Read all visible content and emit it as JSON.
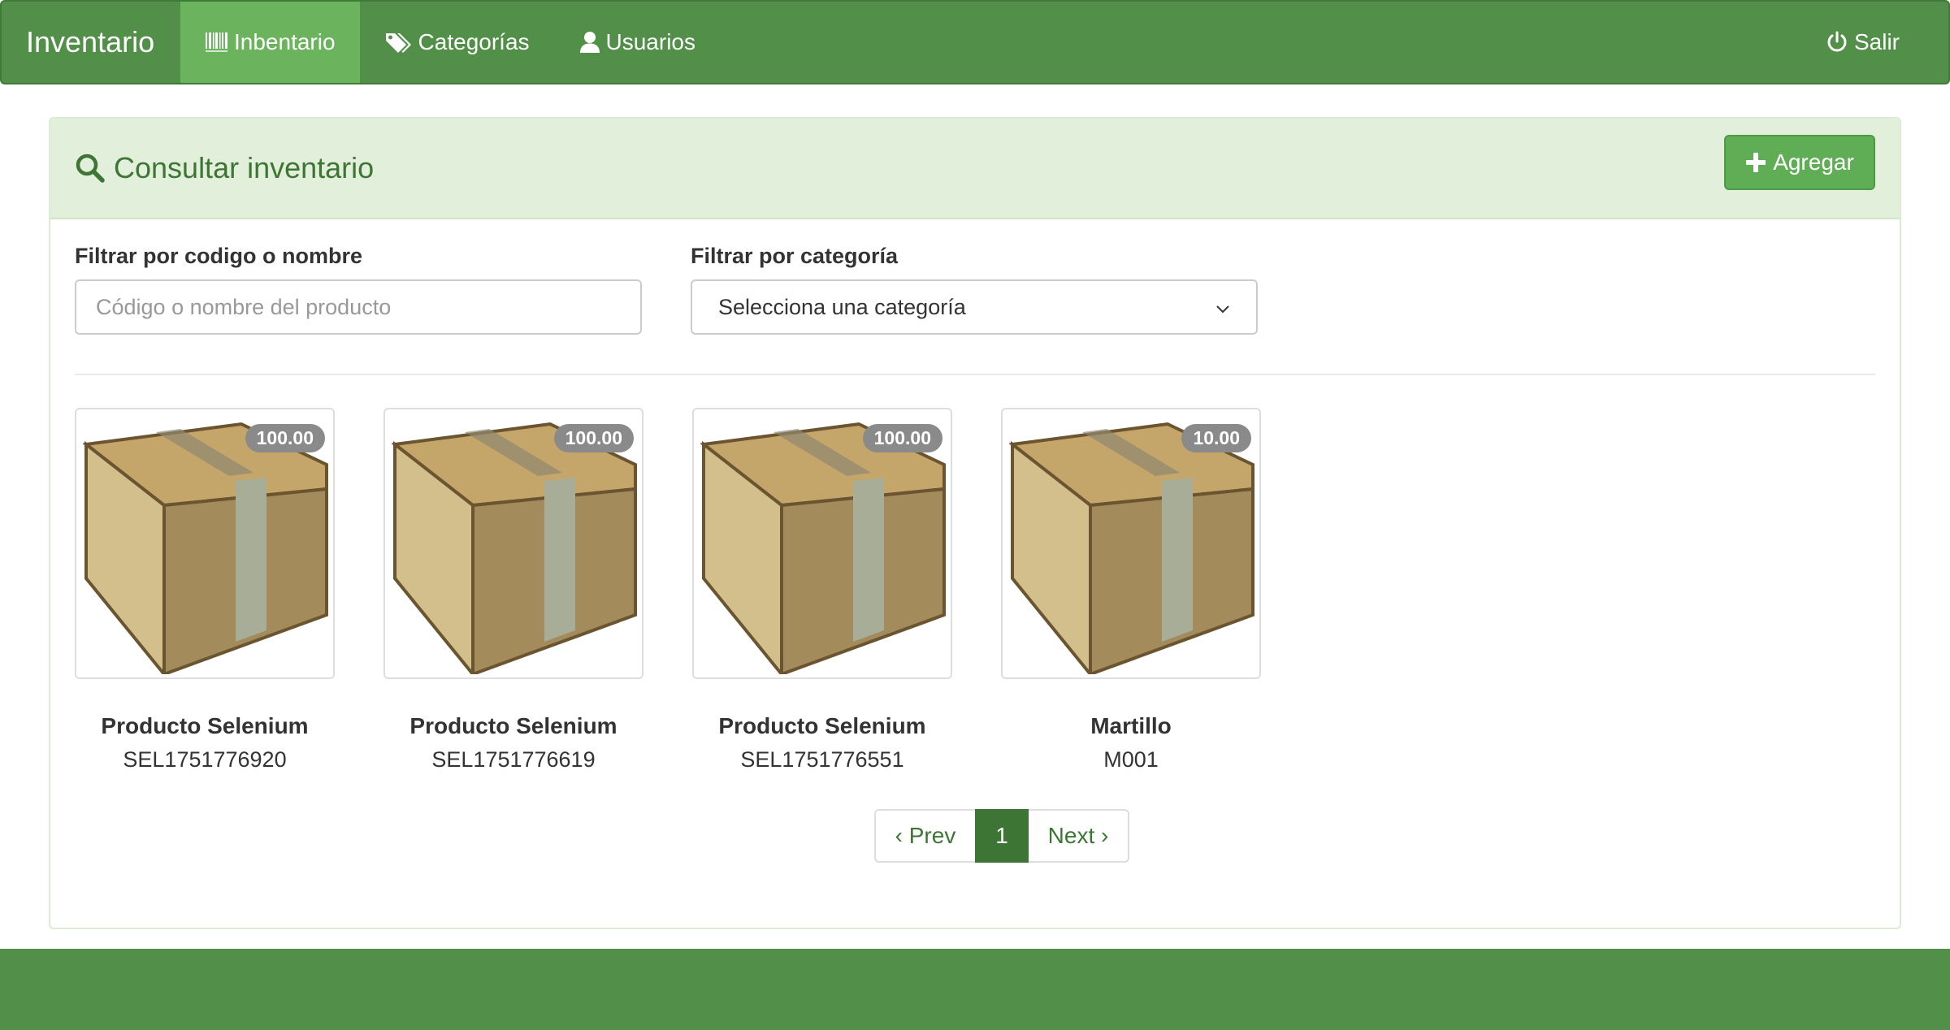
{
  "navbar": {
    "brand": "Inventario",
    "items": [
      {
        "label": "Inbentario",
        "icon": "barcode-icon",
        "active": true
      },
      {
        "label": "Categorías",
        "icon": "tags-icon",
        "active": false
      },
      {
        "label": "Usuarios",
        "icon": "user-icon",
        "active": false
      }
    ],
    "logout_label": "Salir",
    "logout_icon": "power-icon"
  },
  "panel": {
    "title": "Consultar inventario",
    "title_icon": "search-icon",
    "add_label": "Agregar",
    "add_icon": "plus-icon"
  },
  "filters": {
    "name_label": "Filtrar por codigo o nombre",
    "name_placeholder": "Código o nombre del producto",
    "name_value": "",
    "category_label": "Filtrar por categoría",
    "category_selected": "Selecciona una categoría"
  },
  "products": [
    {
      "name": "Producto Selenium",
      "code": "SEL1751776920",
      "quantity": "100.00",
      "image": "box-icon"
    },
    {
      "name": "Producto Selenium",
      "code": "SEL1751776619",
      "quantity": "100.00",
      "image": "box-icon"
    },
    {
      "name": "Producto Selenium",
      "code": "SEL1751776551",
      "quantity": "100.00",
      "image": "box-icon"
    },
    {
      "name": "Martillo",
      "code": "M001",
      "quantity": "10.00",
      "image": "box-icon"
    }
  ],
  "pagination": {
    "prev_label": "‹ Prev",
    "current_page": "1",
    "next_label": "Next ›"
  },
  "colors": {
    "navbar": "#528f48",
    "nav_active": "#6bb35c",
    "panel_heading_bg": "#e2efda",
    "title_color": "#3d7634",
    "add_button": "#5fae55",
    "badge": "#8a8a8a"
  }
}
